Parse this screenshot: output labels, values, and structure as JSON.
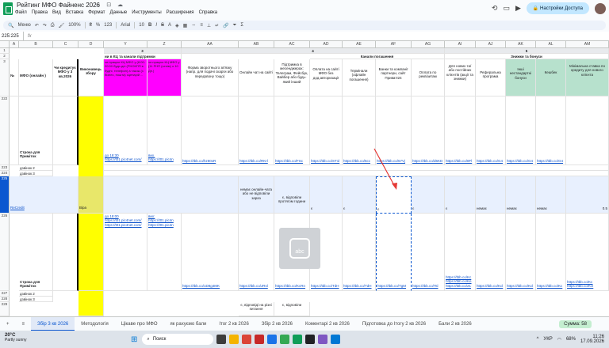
{
  "app": {
    "title": "Рейтинг МФО Файненс 2026",
    "share": "Настройки Доступа"
  },
  "menu": [
    "Файл",
    "Правка",
    "Вид",
    "Вставка",
    "Формат",
    "Данные",
    "Инструменты",
    "Расширения",
    "Справка"
  ],
  "toolbar": {
    "menu": "Меню",
    "zoom": "100%",
    "font": "Arial",
    "size": "10",
    "num123": "123"
  },
  "namebox": "225:225",
  "columns": [
    "",
    "A",
    "B",
    "C",
    "D",
    "Y",
    "Z",
    "AA",
    "AB",
    "AC",
    "AD",
    "AE",
    "AF",
    "AG",
    "AI",
    "AJ",
    "AK",
    "AL",
    "AM"
  ],
  "rows_top": [
    "1",
    "2",
    "3"
  ],
  "headers": {
    "num3": "3",
    "num4": "4",
    "num5": "5",
    "no": "№",
    "mfo": "МФО (онлайн )",
    "credits": "Чи кредитує МФО у 3 кв.2026",
    "exec": "Виконавець збору",
    "y": "ии в КЦ та канали підтримки",
    "ypink": "чи працює КЦ МФО у (8:00-20:00 будь-дні (РНОКПП в будні, телефон) а також (з бізнес, пошта) сценарій ...",
    "zpink": "чи працює КЦ МФО у (11 РНП (сенім) о 10 Дн.)",
    "aa": "Форма зворотнього зв'язку (напр. для подачі скарги або передзвону тощо)",
    "ab": "Онлайн чат на сайті",
    "ac": "Підтримка в месенджерах: Телеграм, Фейсбук, Вайбер або будь-який інший",
    "chan": "Канали погашення",
    "ad": "Оплата на сайті МФО без дод.авторизації",
    "ae": "Термінали (офлайн погашення)",
    "af": "Банки та компанії партнери, сайт ПриватІ24",
    "ag": "Оплата по реквізитам",
    "bonus": "Знижки та бонуси",
    "ai": "Для нових та/або постійних клієнтів (акції та знижки)",
    "aj": "Реферальна програма",
    "ak": "Інші нестандартні бонуси",
    "al": "Кешбек",
    "am": "Мінімальна ставка по кредиту для нового клієнта"
  },
  "rows": {
    "r222": "222",
    "r223": "223",
    "r224": "224",
    "r225": "225",
    "r226": "226",
    "r227": "227",
    "r228": "228",
    "r229": "229",
    "stroka": "Строка для Приміток",
    "dzv2": "дзвінок 2",
    "dzv3": "дзвінок 3",
    "ycell": "до 18:30 https://t01.pic4net.com/",
    "zcell": "вих. https://t01.pic4n",
    "aalink": "https://tbb.co/hz80xR",
    "ablink": "https://tbb.co/RKrl",
    "aclink": "https://tbb.co/FSc",
    "adlink": "https://tbb.co/ST1l",
    "aelink": "https://tbb.co/5cc",
    "aflink": "https://tbb.co/57Vj",
    "aglink": "https://tbb.co/d6KD",
    "ailink": "https://tbb.co/8Fl",
    "ajlink": "https://tbb.co/G4",
    "aklink": "https://tbb.co/G4",
    "allink": "https://tbb.co/G4",
    "recredit": "ReCredit",
    "vira": "Віра",
    "nemaechat": "немає онлайн-чата або не відповіли зараз",
    "nezv": "є, відповіли протягом години",
    "e": "є",
    "nemae": "немає",
    "val05": "0.5",
    "y226": "до 18:00 https://t01.pic4net.com/ https://t01.pic4net.com/",
    "z226": "вих: https://t01.pic4n https://t01.pic4n",
    "aa226": "https://tbb.co/1D8g4MK",
    "ab226": "https://tbb.co/JRsl",
    "ac226": "https://tbb.co/KcRn",
    "ad226": "https://tbb.co/TdH",
    "ae226": "https://tbb.co/TdH",
    "af226": "https://tbb.co/TgM",
    "ag226": "https://tbb.co/Tsl",
    "ai226": "https://tbb.co/Kc https://tbb.co/Ke https://tbb.co/21",
    "aj226": "https://tbb.co/Kcl",
    "ak226": "https://tbb.co/Kcl",
    "al226": "https://tbb.co/Kc",
    "am226": "https://tbb.co/Kc https://tbb.co/Kcl",
    "r228ab": "є, відповіді на різні питання",
    "r228ac": "є, відповіли"
  },
  "tabs": [
    "Збір 3 кв 2026",
    "Методологія",
    "Цікаве про МФО",
    "як рахуємо бали",
    "Ітог 2 кв 2026",
    "Збір 2 кв 2026",
    "Коментарі 2 кв 2026",
    "Підготовка до Ітогу 2 кв 2026",
    "Бали 2 кв 2026",
    "УКР"
  ],
  "sum": "Сумма: 58",
  "taskbar": {
    "temp": "20°C",
    "weather": "Partly sunny",
    "search": "Поиск",
    "lang": "УКР",
    "time": "11:26",
    "date": "17.09.2026",
    "battery": "68%"
  },
  "colors": {
    "yellow": "#ffff00",
    "pink": "#ff00ff",
    "green": "#b7e1cd",
    "blue_sel": "#e8f0fe",
    "tab_active": "#0b57d0"
  }
}
